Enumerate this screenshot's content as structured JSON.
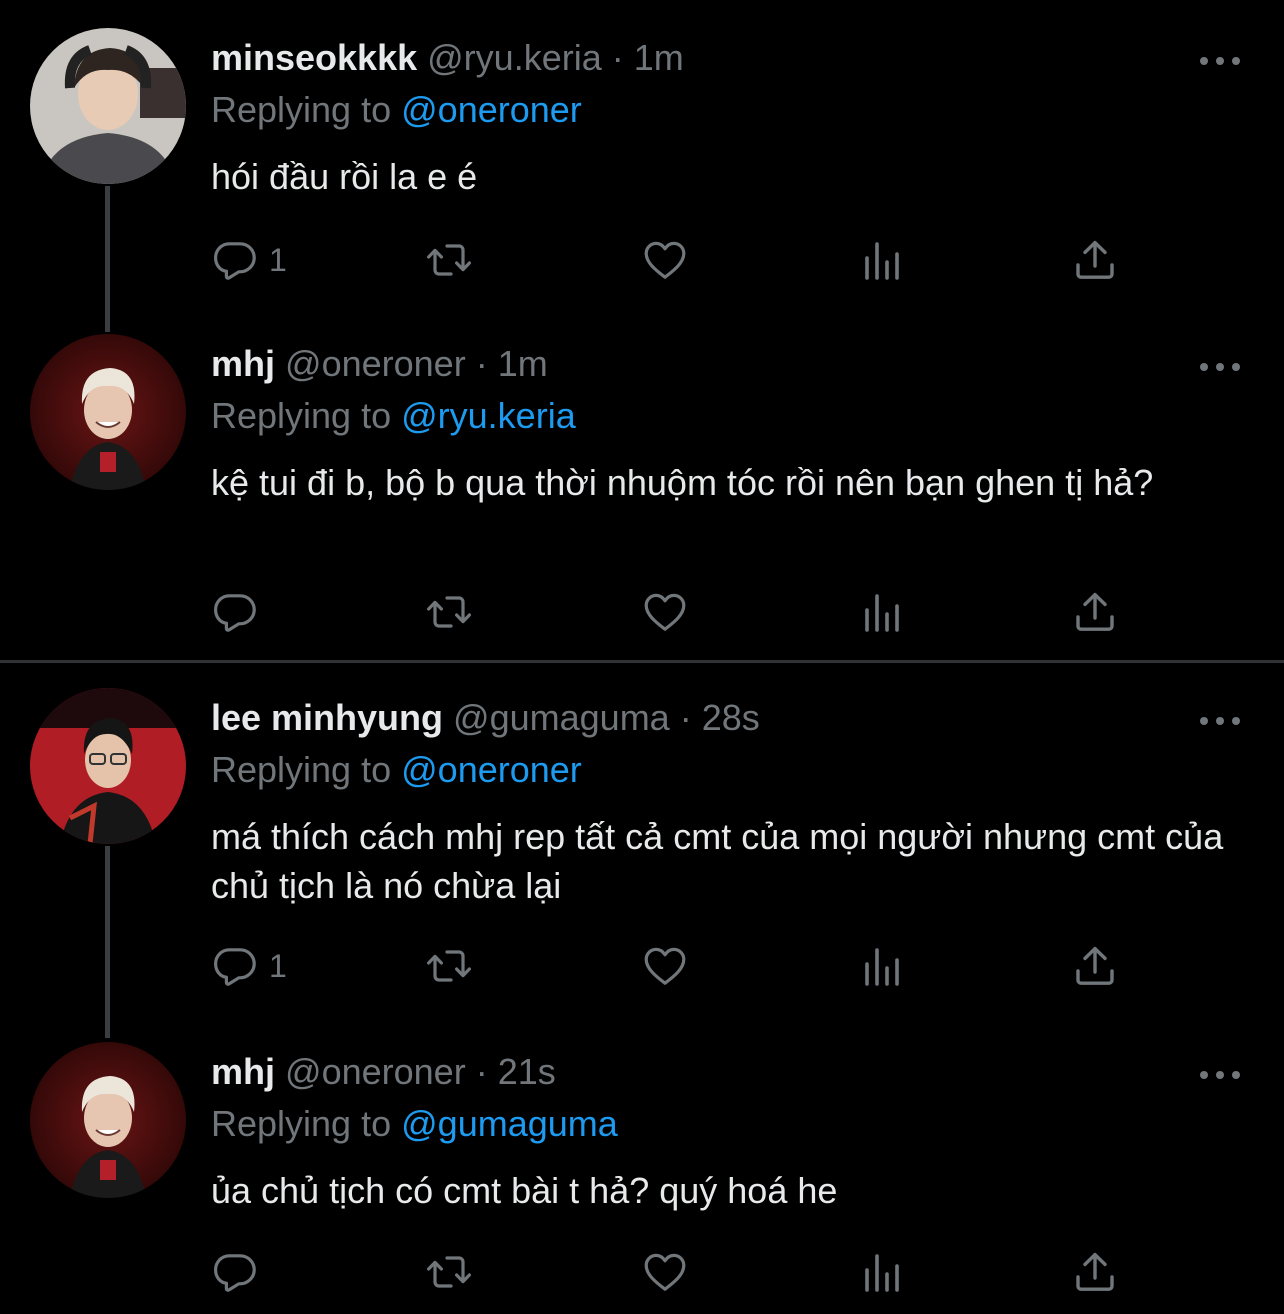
{
  "colors": {
    "background": "#000000",
    "text": "#e7e9ea",
    "muted": "#71767b",
    "mention": "#1d9bf0",
    "divider": "#2f3336"
  },
  "icons": {
    "reply": "reply-icon",
    "retweet": "retweet-icon",
    "like": "heart-icon",
    "views": "analytics-icon",
    "share": "share-icon",
    "more": "more-dots-icon"
  },
  "tweets": [
    {
      "name": "minseokkkk",
      "handle": "@ryu.keria",
      "separator": "·",
      "time": "1m",
      "replying_label": "Replying to",
      "replying_to": "@oneroner",
      "text": "hói đầu rồi la e é",
      "reply_count": "1"
    },
    {
      "name": "mhj",
      "handle": "@oneroner",
      "separator": "·",
      "time": "1m",
      "replying_label": "Replying to",
      "replying_to": "@ryu.keria",
      "text": "kệ tui đi b, bộ b qua thời nhuộm tóc rồi nên bạn ghen tị hả?",
      "reply_count": ""
    },
    {
      "name": "lee minhyung",
      "handle": "@gumaguma",
      "separator": "·",
      "time": "28s",
      "replying_label": "Replying to",
      "replying_to": "@oneroner",
      "text": "má thích cách mhj rep tất cả cmt của mọi người nhưng cmt của chủ tịch là nó chừa lại",
      "reply_count": "1"
    },
    {
      "name": "mhj",
      "handle": "@oneroner",
      "separator": "·",
      "time": "21s",
      "replying_label": "Replying to",
      "replying_to": "@gumaguma",
      "text": "ủa chủ tịch có cmt bài t hả? quý hoá he",
      "reply_count": ""
    }
  ]
}
